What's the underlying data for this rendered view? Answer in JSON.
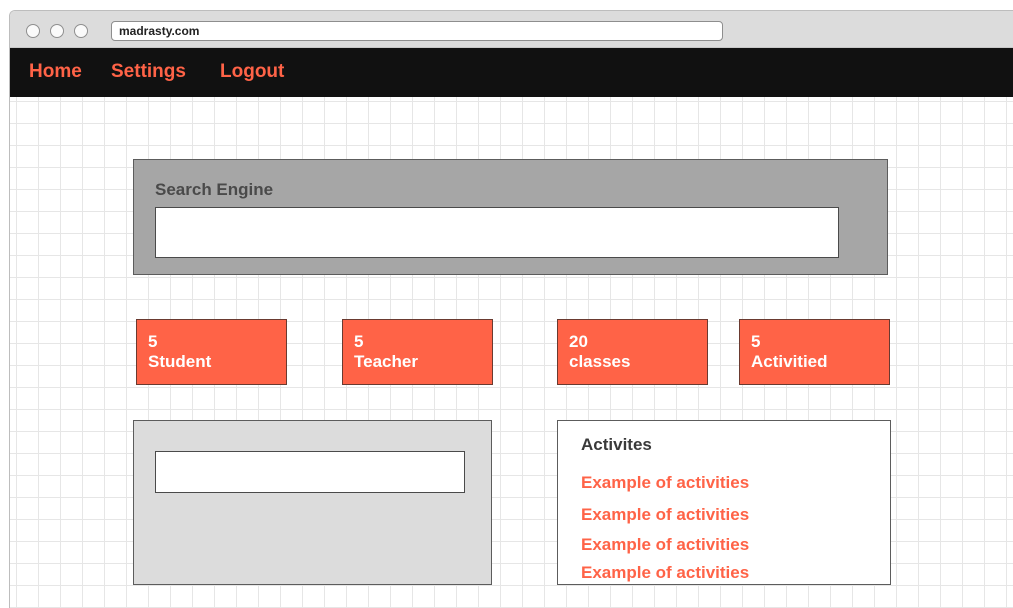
{
  "browser": {
    "url": "madrasty.com"
  },
  "nav": {
    "items": [
      {
        "label": "Home"
      },
      {
        "label": "Settings"
      },
      {
        "label": "Logout"
      }
    ]
  },
  "search": {
    "title": "Search Engine",
    "value": "",
    "placeholder": ""
  },
  "stats": [
    {
      "count": "5",
      "label": "Student"
    },
    {
      "count": "5",
      "label": "Teacher"
    },
    {
      "count": "20",
      "label": "classes"
    },
    {
      "count": "5",
      "label": "Activitied"
    }
  ],
  "left_panel": {
    "input_value": ""
  },
  "activities": {
    "title": "Activites",
    "items": [
      {
        "label": "Example of activities"
      },
      {
        "label": "Example of activities"
      },
      {
        "label": "Example of activities"
      },
      {
        "label": "Example of activities"
      }
    ]
  },
  "colors": {
    "accent": "#ff6347",
    "navbar": "#111111",
    "search_panel": "#a6a6a6",
    "left_panel": "#dcdcdc"
  }
}
